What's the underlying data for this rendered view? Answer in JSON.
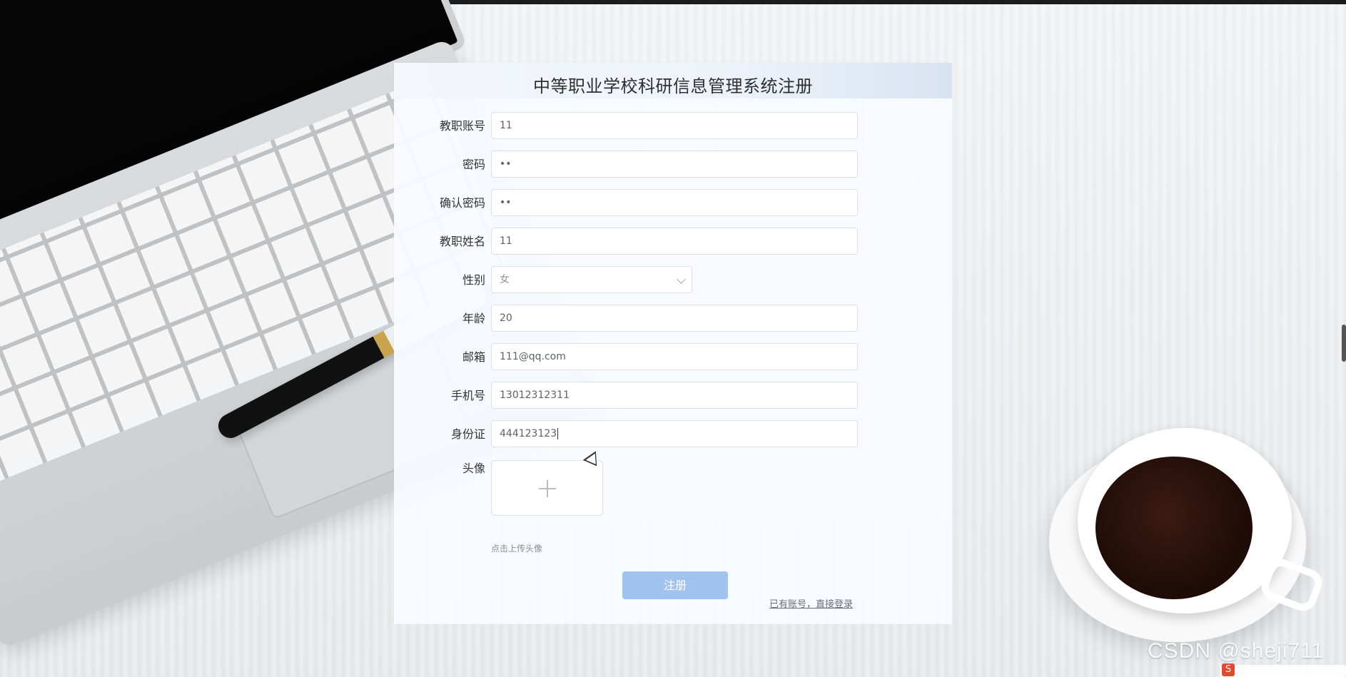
{
  "form": {
    "title": "中等职业学校科研信息管理系统注册",
    "fields": [
      {
        "label": "教职账号",
        "value": "11"
      },
      {
        "label": "密码",
        "value": "••"
      },
      {
        "label": "确认密码",
        "value": "••"
      },
      {
        "label": "教职姓名",
        "value": "11"
      },
      {
        "label": "性别",
        "value": "女"
      },
      {
        "label": "年龄",
        "value": "20"
      },
      {
        "label": "邮箱",
        "value": "111@qq.com"
      },
      {
        "label": "手机号",
        "value": "13012312311"
      },
      {
        "label": "身份证",
        "value": "444123123"
      },
      {
        "label": "头像"
      }
    ],
    "upload_hint": "点击上传头像",
    "submit_label": "注册",
    "login_link": "已有账号，直接登录"
  },
  "watermark": "CSDN @sheji711",
  "tray": {
    "ime_icon": "S"
  },
  "colors": {
    "button": "#a0c3f0",
    "panel": "#f8fbff",
    "border": "#dcdfe6"
  }
}
